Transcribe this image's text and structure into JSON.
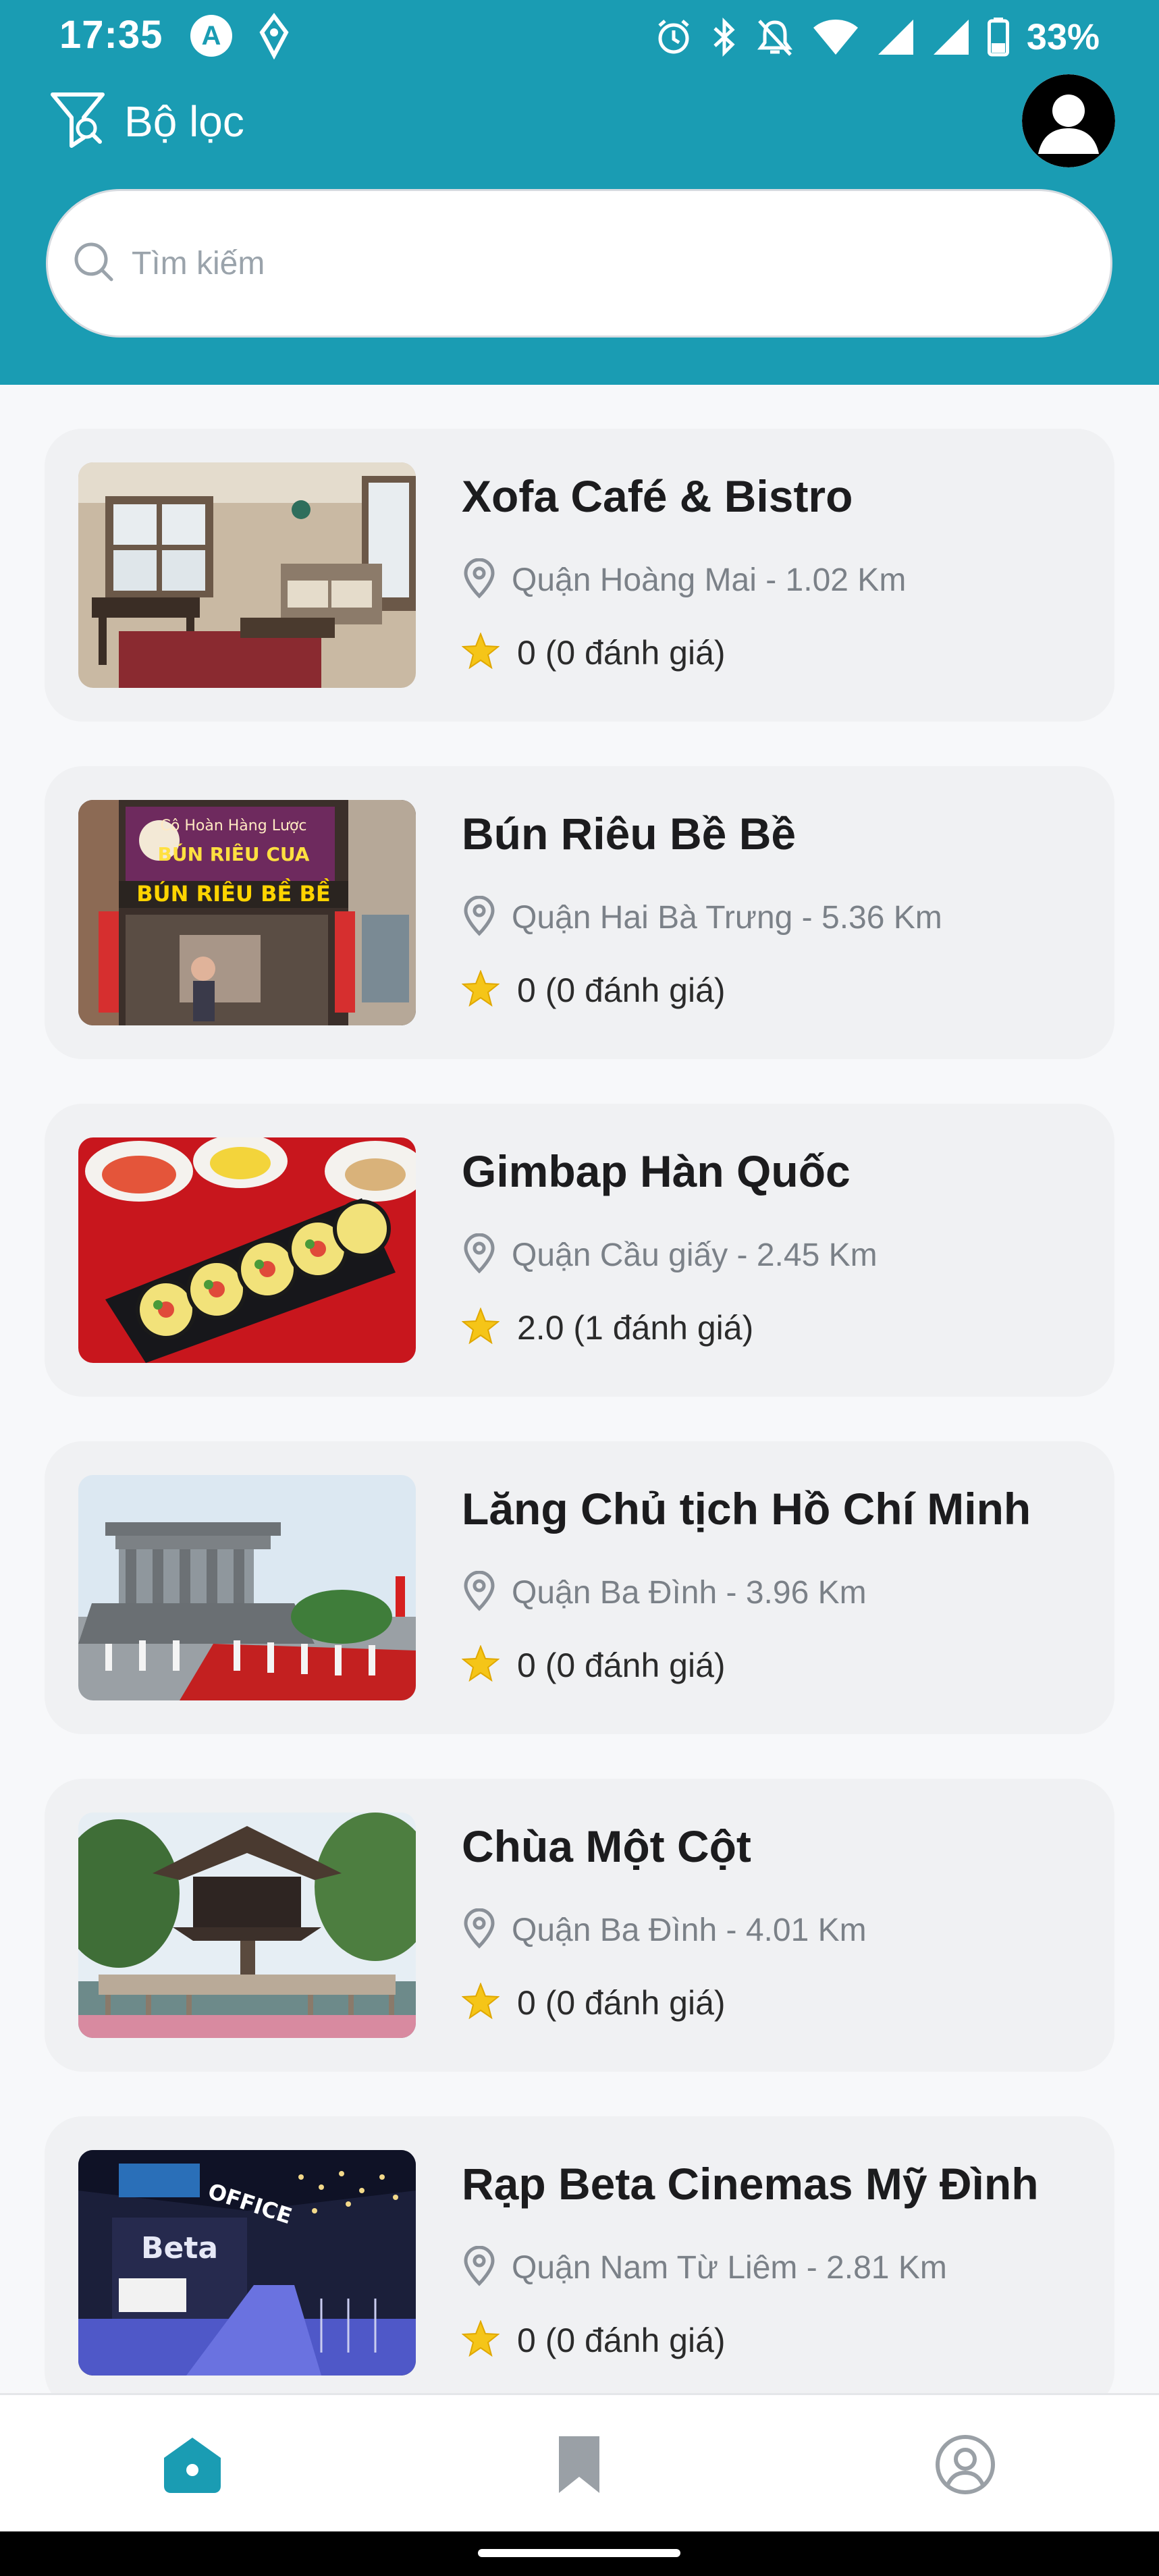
{
  "status_bar": {
    "time": "17:35",
    "app_icon_1": "A",
    "battery": "33%",
    "icons": [
      "alarm-icon",
      "bluetooth-icon",
      "mute-icon",
      "wifi-icon",
      "signal-icon",
      "signal-icon",
      "battery-icon"
    ]
  },
  "header": {
    "filter_label": "Bộ lọc",
    "search_placeholder": "Tìm kiếm"
  },
  "places": [
    {
      "name": "Xofa Café & Bistro",
      "location": "Quận Hoàng Mai - 1.02 Km",
      "rating": "0 (0 đánh giá)",
      "image": "cafe-interior"
    },
    {
      "name": "Bún Riêu Bề Bề",
      "location": "Quận Hai Bà Trưng - 5.36 Km",
      "rating": "0 (0 đánh giá)",
      "image": "shop-front"
    },
    {
      "name": "Gimbap Hàn Quốc",
      "location": "Quận Cầu giấy - 2.45 Km",
      "rating": "2.0 (1 đánh giá)",
      "image": "gimbap-plate"
    },
    {
      "name": "Lăng Chủ tịch Hồ Chí Minh",
      "location": "Quận Ba Đình - 3.96 Km",
      "rating": "0 (0 đánh giá)",
      "image": "mausoleum"
    },
    {
      "name": "Chùa Một Cột",
      "location": "Quận Ba Đình - 4.01 Km",
      "rating": "0 (0 đánh giá)",
      "image": "pagoda"
    },
    {
      "name": "Rạp Beta Cinemas Mỹ Đình",
      "location": "Quận Nam Từ Liêm - 2.81 Km",
      "rating": "0 (0 đánh giá)",
      "image": "cinema-lobby"
    }
  ],
  "image_banner_text": {
    "shop_sign_top": "Cô Hoàn Hàng Lược",
    "shop_sign_mid": "BÚN RIÊU CUA",
    "shop_sign_bottom": "BÚN RIÊU BỀ BỀ",
    "cinema_office": "OFFICE",
    "cinema_logo": "Beta"
  },
  "bottom_nav": {
    "items": [
      "home-icon",
      "bookmark-icon",
      "profile-icon"
    ],
    "active": "home-icon"
  },
  "colors": {
    "primary": "#1a9cb3",
    "star": "#f5c518",
    "card_bg": "#f0f1f3"
  }
}
